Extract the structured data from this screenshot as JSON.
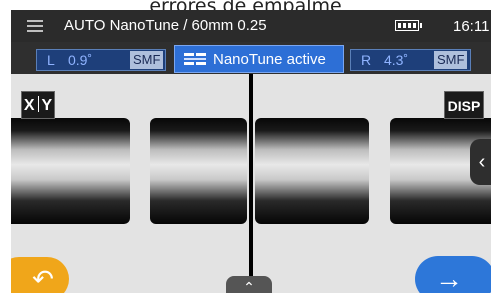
{
  "caption": "errores de empalme",
  "header": {
    "title": "AUTO NanoTune / 60mm 0.25",
    "time": "16:11",
    "menu_icon": "hamburger-menu-icon",
    "battery_icon": "battery-full-icon"
  },
  "status": {
    "left": {
      "side": "L",
      "angle": "0.9˚",
      "mode": "SMF"
    },
    "center": {
      "label": "NanoTune active",
      "icon": "nanotune-icon"
    },
    "right": {
      "side": "R",
      "angle": "4.3˚",
      "mode": "SMF"
    }
  },
  "controls": {
    "xy_left": "X",
    "xy_right": "Y",
    "disp": "DISP",
    "side_tab_glyph": "‹",
    "back_glyph": "↶",
    "next_glyph": "→",
    "up_glyph": "⌃"
  },
  "colors": {
    "accent_blue": "#2d77d9",
    "back_orange": "#f0a61a",
    "status_bg": "#1e3f7a"
  }
}
